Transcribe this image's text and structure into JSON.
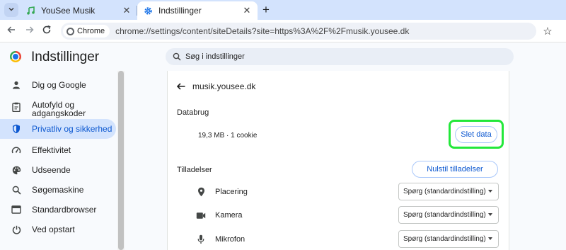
{
  "browser": {
    "tabs": [
      {
        "title": "YouSee Musik",
        "icon": "music-note-icon",
        "active": false
      },
      {
        "title": "Indstillinger",
        "icon": "settings-gear-icon",
        "active": true
      }
    ],
    "new_tab_symbol": "+",
    "chip_label": "Chrome",
    "url": "chrome://settings/content/siteDetails?site=https%3A%2F%2Fmusik.yousee.dk"
  },
  "header": {
    "title": "Indstillinger",
    "search_placeholder": "Søg i indstillinger"
  },
  "sidebar": {
    "items": [
      {
        "label": "Dig og Google",
        "icon": "person-icon",
        "active": false
      },
      {
        "label": "Autofyld og adgangskoder",
        "icon": "clipboard-icon",
        "active": false
      },
      {
        "label": "Privatliv og sikkerhed",
        "icon": "shield-icon",
        "active": true
      },
      {
        "label": "Effektivitet",
        "icon": "speedometer-icon",
        "active": false
      },
      {
        "label": "Udseende",
        "icon": "palette-icon",
        "active": false
      },
      {
        "label": "Søgemaskine",
        "icon": "search-icon",
        "active": false
      },
      {
        "label": "Standardbrowser",
        "icon": "browser-window-icon",
        "active": false
      },
      {
        "label": "Ved opstart",
        "icon": "power-icon",
        "active": false
      }
    ]
  },
  "site": {
    "name": "musik.yousee.dk",
    "usage_title": "Databrug",
    "usage_text": "19,3 MB · 1 cookie",
    "delete_button": "Slet data",
    "permissions_title": "Tilladelser",
    "reset_button": "Nulstil tilladelser",
    "permissions": [
      {
        "label": "Placering",
        "icon": "location-pin-icon",
        "value": "Spørg (standardindstilling)"
      },
      {
        "label": "Kamera",
        "icon": "camera-icon",
        "value": "Spørg (standardindstilling)"
      },
      {
        "label": "Mikrofon",
        "icon": "microphone-icon",
        "value": "Spørg (standardindstilling)"
      }
    ]
  },
  "colors": {
    "accent": "#0b57d0",
    "tabstrip": "#d3e3fd",
    "highlight": "#23e83a"
  }
}
